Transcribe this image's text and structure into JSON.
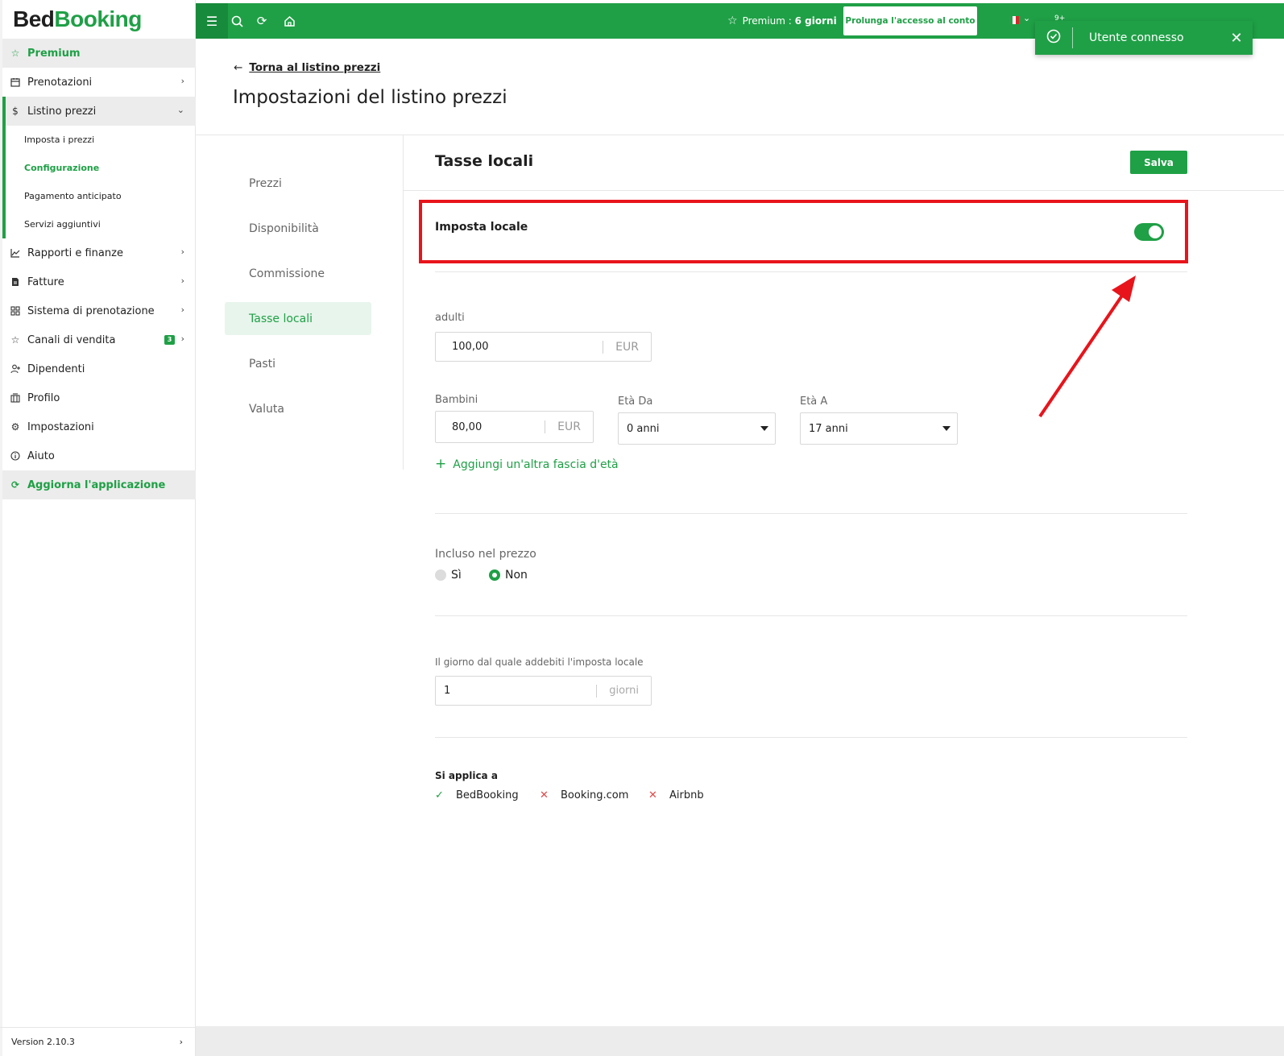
{
  "logo": {
    "part1": "Bed",
    "part2": "Booking"
  },
  "sidebar": {
    "premium": "Premium",
    "items": [
      {
        "label": "Prenotazioni"
      },
      {
        "label": "Listino prezzi"
      },
      {
        "label": "Rapporti e finanze"
      },
      {
        "label": "Fatture"
      },
      {
        "label": "Sistema di prenotazione"
      },
      {
        "label": "Canali di vendita",
        "badge": "3"
      },
      {
        "label": "Dipendenti"
      },
      {
        "label": "Profilo"
      },
      {
        "label": "Impostazioni"
      },
      {
        "label": "Aiuto"
      }
    ],
    "subitems": [
      {
        "label": "Imposta i prezzi"
      },
      {
        "label": "Configurazione"
      },
      {
        "label": "Pagamento anticipato"
      },
      {
        "label": "Servizi aggiuntivi"
      }
    ],
    "update": "Aggiorna l'applicazione",
    "version": "Version 2.10.3"
  },
  "topbar": {
    "premium_label": "Premium : ",
    "premium_days": "6 giorni",
    "extend_button": "Prolunga l'accesso al conto",
    "notif_count": "9+"
  },
  "toast": {
    "message": "Utente connesso"
  },
  "header": {
    "back_link": "Torna al listino prezzi",
    "title": "Impostazioni del listino prezzi"
  },
  "settings_nav": [
    "Prezzi",
    "Disponibilità",
    "Commissione",
    "Tasse locali",
    "Pasti",
    "Valuta"
  ],
  "panel": {
    "title": "Tasse locali",
    "save": "Salva",
    "toggle_label": "Imposta locale",
    "toggle_on": true,
    "adults_label": "adulti",
    "adults_value": "100,00",
    "adults_unit": "EUR",
    "children_label": "Bambini",
    "children_value": "80,00",
    "children_unit": "EUR",
    "age_from_label": "Età Da",
    "age_from_value": "0 anni",
    "age_to_label": "Età A",
    "age_to_value": "17 anni",
    "add_age_range": "Aggiungi un'altra fascia d'età",
    "included_label": "Incluso nel prezzo",
    "included_yes": "Sì",
    "included_no": "Non",
    "included_selected": "Non",
    "day_label": "Il giorno dal quale addebiti l'imposta locale",
    "day_value": "1",
    "day_unit": "giorni",
    "applies_title": "Si applica a",
    "applies": [
      {
        "name": "BedBooking",
        "enabled": true
      },
      {
        "name": "Booking.com",
        "enabled": false
      },
      {
        "name": "Airbnb",
        "enabled": false
      }
    ]
  },
  "colors": {
    "brand_green": "#1fa046",
    "highlight_red": "#e8141b"
  }
}
